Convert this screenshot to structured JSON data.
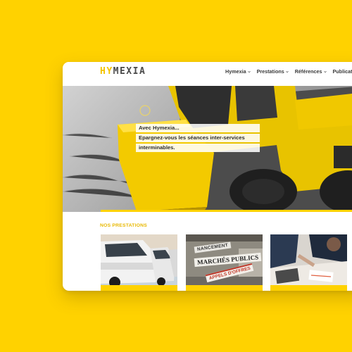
{
  "brand": {
    "logo_part1": "HY",
    "logo_part2": "MEXIA",
    "accent_color": "#FFD200"
  },
  "nav": {
    "items": [
      {
        "label": "Hymexia",
        "icon": "chevron-down-icon"
      },
      {
        "label": "Prestations",
        "icon": "chevron-down-icon"
      },
      {
        "label": "Références",
        "icon": "chevron-down-icon"
      },
      {
        "label": "Publicat"
      }
    ]
  },
  "hero": {
    "line1": "Avec Hymexia...",
    "line2": "Epargnez-vous les séances inter-services",
    "line3": "interminables."
  },
  "section": {
    "title": "NOS PRESTATIONS"
  },
  "cards": {
    "card2": {
      "label_a": "NANCEMENT",
      "label_b": "MARCHÉS PUBLICS",
      "label_c": "APPELS D'OFFRES"
    }
  }
}
